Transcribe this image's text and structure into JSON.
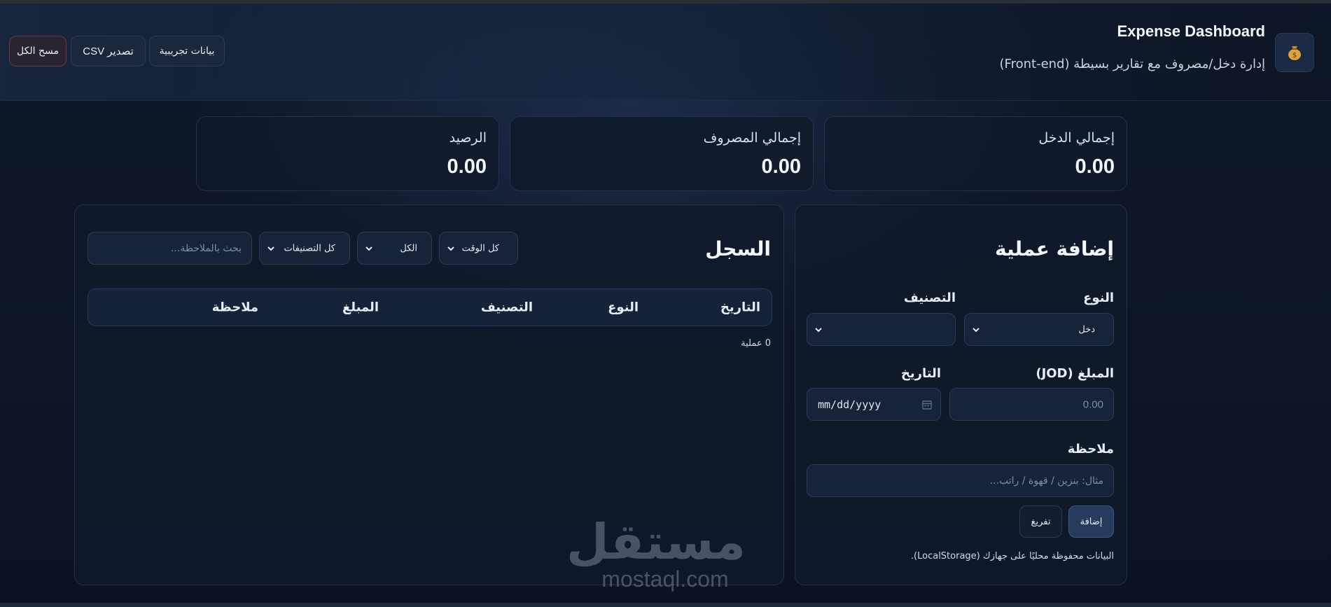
{
  "header": {
    "title": "Expense Dashboard",
    "subtitle": "إدارة دخل/مصروف مع تقارير بسيطة (Front-end)",
    "logo_icon": "money-bag-icon",
    "buttons": {
      "demo": "بيانات تجريبية",
      "csv": "تصدير CSV",
      "clear": "مسح الكل"
    }
  },
  "stats": {
    "income": {
      "label": "إجمالي الدخل",
      "value": "0.00"
    },
    "expense": {
      "label": "إجمالي المصروف",
      "value": "0.00"
    },
    "balance": {
      "label": "الرصيد",
      "value": "0.00"
    }
  },
  "add_form": {
    "title": "إضافة عملية",
    "type_label": "النوع",
    "type_value": "دخل",
    "category_label": "التصنيف",
    "category_value": "",
    "amount_label": "المبلغ (JOD)",
    "amount_placeholder": "0.00",
    "date_label": "التاريخ",
    "date_placeholder": "mm/dd/yyyy",
    "note_label": "ملاحظة",
    "note_placeholder": "مثال: بنزين / قهوة / راتب...",
    "add_button": "إضافة",
    "reset_button": "تفريغ",
    "storage_note": "البيانات محفوظة محليًا على جهازك (LocalStorage)."
  },
  "log": {
    "title": "السجل",
    "filters": {
      "time": "كل الوقت",
      "type": "الكل",
      "category": "كل التصنيفات",
      "search_placeholder": "بحث بالملاحظة..."
    },
    "columns": [
      "التاريخ",
      "النوع",
      "التصنيف",
      "المبلغ",
      "ملاحظة"
    ],
    "count_text": "0 عملية"
  },
  "watermark": {
    "arabic": "مستقل",
    "latin": "mostaql.com"
  },
  "colors": {
    "background": "#0e1628",
    "card": "#111a2c",
    "accent_button": "#263c5d",
    "danger_border": "#6a3a3e"
  }
}
